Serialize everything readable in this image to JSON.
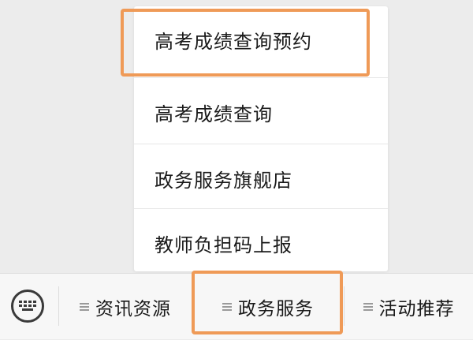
{
  "popup_menu": {
    "items": [
      {
        "label": "高考成绩查询预约"
      },
      {
        "label": "高考成绩查询"
      },
      {
        "label": "政务服务旗舰店"
      },
      {
        "label": "教师负担码上报"
      }
    ]
  },
  "bottom_bar": {
    "keyboard_icon": "keyboard-icon",
    "tabs": [
      {
        "label": "资讯资源",
        "icon": "menu-list-icon"
      },
      {
        "label": "政务服务",
        "icon": "menu-list-icon"
      },
      {
        "label": "活动推荐",
        "icon": "menu-list-icon"
      }
    ]
  },
  "colors": {
    "highlight": "#ef9a57",
    "background": "#ececec",
    "popup": "#ffffff",
    "bar": "#f7f7f7"
  }
}
